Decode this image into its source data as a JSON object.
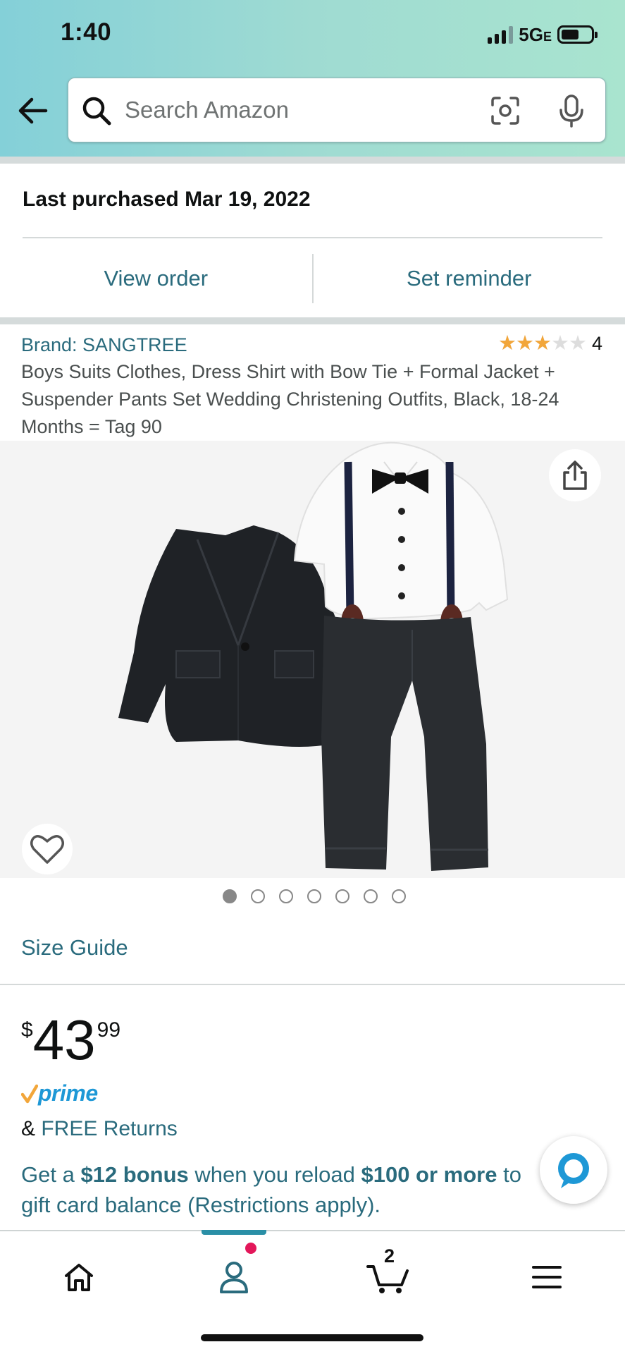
{
  "status_bar": {
    "time": "1:40",
    "network": "5G",
    "network_suffix": "E"
  },
  "search": {
    "placeholder": "Search Amazon"
  },
  "purchase": {
    "last_purchased": "Last purchased Mar 19, 2022",
    "view_order": "View order",
    "set_reminder": "Set reminder"
  },
  "product": {
    "brand": "Brand: SANGTREE",
    "rating": 3,
    "rating_max": 5,
    "rating_count": "4",
    "title": "Boys Suits Clothes, Dress Shirt with Bow Tie + Formal Jacket + Suspender Pants Set Wedding Christening Outfits, Black, 18-24 Months = Tag 90",
    "image_count": 7,
    "active_image": 0,
    "size_guide": "Size Guide",
    "price": {
      "currency": "$",
      "whole": "43",
      "fraction": "99"
    },
    "prime_label": "prime",
    "returns_prefix": "&",
    "returns_link": "FREE Returns",
    "promo": {
      "part1": "Get a ",
      "bonus": "$12 bonus",
      "part2": " when you reload ",
      "amount": "$100 or more",
      "part3": " to",
      "part4": "gift card balance (Restrictions apply)."
    }
  },
  "nav": {
    "cart_count": "2"
  },
  "colors": {
    "link": "#2a6b7d",
    "star": "#f2a63a",
    "prime_blue": "#1e98d6",
    "nav_accent": "#2a8fa6",
    "badge": "#e3175a"
  }
}
